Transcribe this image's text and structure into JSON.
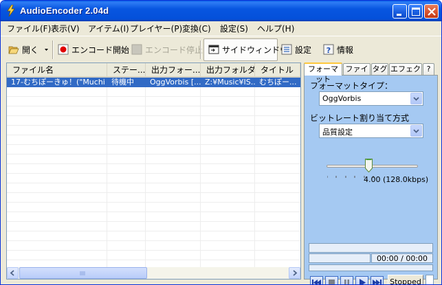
{
  "window": {
    "title": "AudioEncoder 2.04d"
  },
  "menu": [
    "ファイル(F)",
    "表示(V)",
    "アイテム(I)",
    "プレイヤー(P)",
    "変換(C)",
    "設定(S)",
    "ヘルプ(H)"
  ],
  "toolbar": {
    "open": "開く",
    "start_encode": "エンコード開始",
    "stop_encode": "エンコード停止",
    "side_window": "サイドウィンドウ",
    "settings": "設定",
    "info": "情報"
  },
  "list": {
    "columns": [
      "ファイル名",
      "ステー...",
      "出力フォー...",
      "出力フォルダ",
      "タイトル"
    ],
    "rows": [
      [
        "17-むちぽーきゅ！(\"Muchi ...",
        "待機中",
        "OggVorbis [...",
        "Z:¥Music¥IS...",
        "むちぽー..."
      ]
    ]
  },
  "sidepanel": {
    "tabs": [
      "フォーマット",
      "ファイル",
      "タグ",
      "エフェクト",
      "?"
    ],
    "format_type_label": "フォーマットタイプ：",
    "format_type_value": "OggVorbis",
    "bitrate_label": "ビットレート割り当て方式",
    "bitrate_value": "品質設定",
    "quality_readout": "4.00 (128.0kbps)",
    "quality_level": 4.0,
    "time": "00:00 / 00:00",
    "player_status": "Stopped"
  },
  "colors": {
    "title_bar": "#0454DA",
    "selection": "#316AC5",
    "panel_bg": "#A5C9F2",
    "tab_highlight": "#FFC83C"
  }
}
